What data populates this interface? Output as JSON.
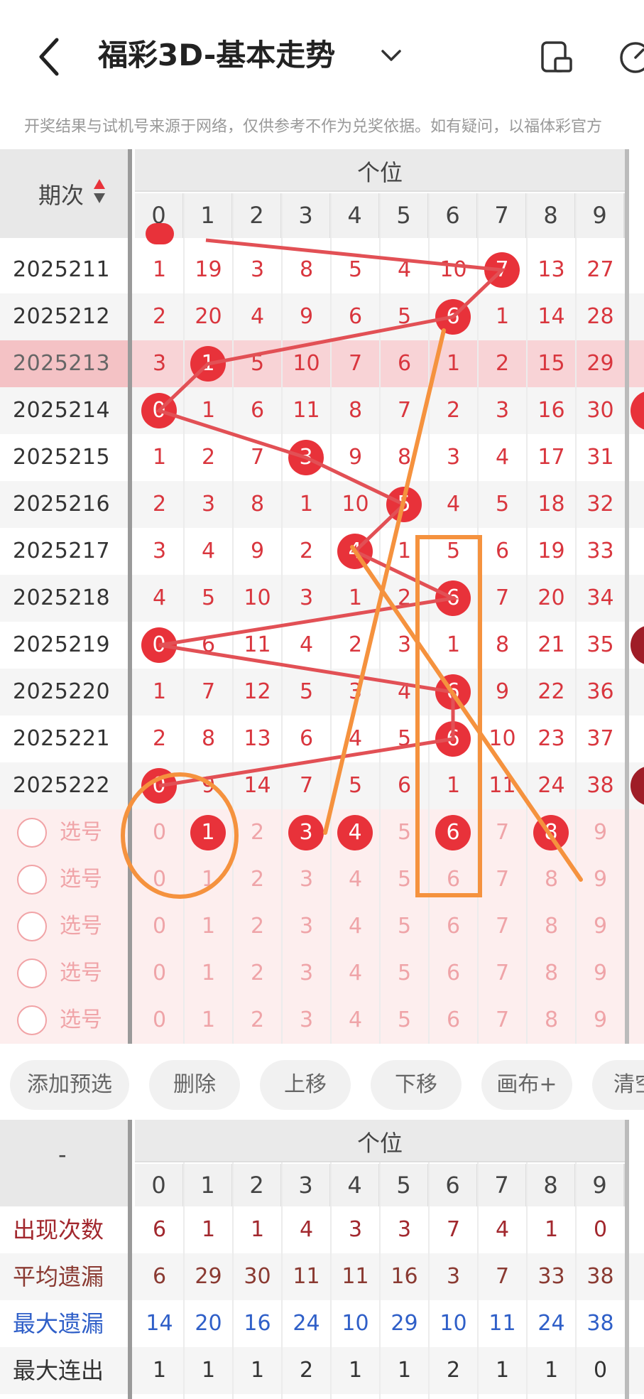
{
  "header": {
    "title": "福彩3D-基本走势",
    "disclaimer": "开奖结果与试机号来源于网络，仅供参考不作为兑奖依据。如有疑问，以福体彩官方"
  },
  "grid": {
    "period_header": "期次",
    "group_header": "个位",
    "digits": [
      "0",
      "1",
      "2",
      "3",
      "4",
      "5",
      "6",
      "7",
      "8",
      "9"
    ],
    "rows": [
      {
        "period": "2025211",
        "values": [
          "1",
          "19",
          "3",
          "8",
          "5",
          "4",
          "10",
          "7",
          "13",
          "27"
        ],
        "hit": 7
      },
      {
        "period": "2025212",
        "values": [
          "2",
          "20",
          "4",
          "9",
          "6",
          "5",
          "6",
          "1",
          "14",
          "28"
        ],
        "hit": 6
      },
      {
        "period": "2025213",
        "values": [
          "3",
          "1",
          "5",
          "10",
          "7",
          "6",
          "1",
          "2",
          "15",
          "29"
        ],
        "hit": 1
      },
      {
        "period": "2025214",
        "values": [
          "0",
          "1",
          "6",
          "11",
          "8",
          "7",
          "2",
          "3",
          "16",
          "30"
        ],
        "hit": 0
      },
      {
        "period": "2025215",
        "values": [
          "1",
          "2",
          "7",
          "3",
          "9",
          "8",
          "3",
          "4",
          "17",
          "31"
        ],
        "hit": 3
      },
      {
        "period": "2025216",
        "values": [
          "2",
          "3",
          "8",
          "1",
          "10",
          "5",
          "4",
          "5",
          "18",
          "32"
        ],
        "hit": 5
      },
      {
        "period": "2025217",
        "values": [
          "3",
          "4",
          "9",
          "2",
          "4",
          "1",
          "5",
          "6",
          "19",
          "33"
        ],
        "hit": 4
      },
      {
        "period": "2025218",
        "values": [
          "4",
          "5",
          "10",
          "3",
          "1",
          "2",
          "6",
          "7",
          "20",
          "34"
        ],
        "hit": 6
      },
      {
        "period": "2025219",
        "values": [
          "0",
          "6",
          "11",
          "4",
          "2",
          "3",
          "1",
          "8",
          "21",
          "35"
        ],
        "hit": 0
      },
      {
        "period": "2025220",
        "values": [
          "1",
          "7",
          "12",
          "5",
          "3",
          "4",
          "6",
          "9",
          "22",
          "36"
        ],
        "hit": 6
      },
      {
        "period": "2025221",
        "values": [
          "2",
          "8",
          "13",
          "6",
          "4",
          "5",
          "6",
          "10",
          "23",
          "37"
        ],
        "hit": 6
      },
      {
        "period": "2025222",
        "values": [
          "0",
          "9",
          "14",
          "7",
          "5",
          "6",
          "1",
          "11",
          "24",
          "38"
        ],
        "hit": 0
      }
    ],
    "pick_label": "选号",
    "pick_rows": [
      {
        "selected": [
          1,
          3,
          4,
          6,
          8
        ]
      },
      {
        "selected": []
      },
      {
        "selected": []
      },
      {
        "selected": []
      },
      {
        "selected": []
      }
    ]
  },
  "toolbar": {
    "buttons": [
      "添加预选",
      "删除",
      "上移",
      "下移",
      "画布+",
      "清空"
    ]
  },
  "stats": {
    "corner": "-",
    "group_header": "个位",
    "rows": [
      {
        "label": "出现次数",
        "values": [
          "6",
          "1",
          "1",
          "4",
          "3",
          "3",
          "7",
          "4",
          "1",
          "0"
        ],
        "color": "#a2282e"
      },
      {
        "label": "平均遗漏",
        "values": [
          "6",
          "29",
          "30",
          "11",
          "11",
          "16",
          "3",
          "7",
          "33",
          "38"
        ],
        "color": "#8a3a32"
      },
      {
        "label": "最大遗漏",
        "values": [
          "14",
          "20",
          "16",
          "24",
          "10",
          "29",
          "10",
          "11",
          "24",
          "38"
        ],
        "color": "#2f5fc8"
      },
      {
        "label": "最大连出",
        "values": [
          "1",
          "1",
          "1",
          "2",
          "1",
          "1",
          "2",
          "1",
          "1",
          "0"
        ],
        "color": "#333333"
      }
    ]
  },
  "colors": {
    "ball": "#e8323a",
    "trend_line": "#e25055",
    "annotation": "#f5923e",
    "highlight_row": "#f8d3d6",
    "pick_bg": "#fdeeee"
  }
}
